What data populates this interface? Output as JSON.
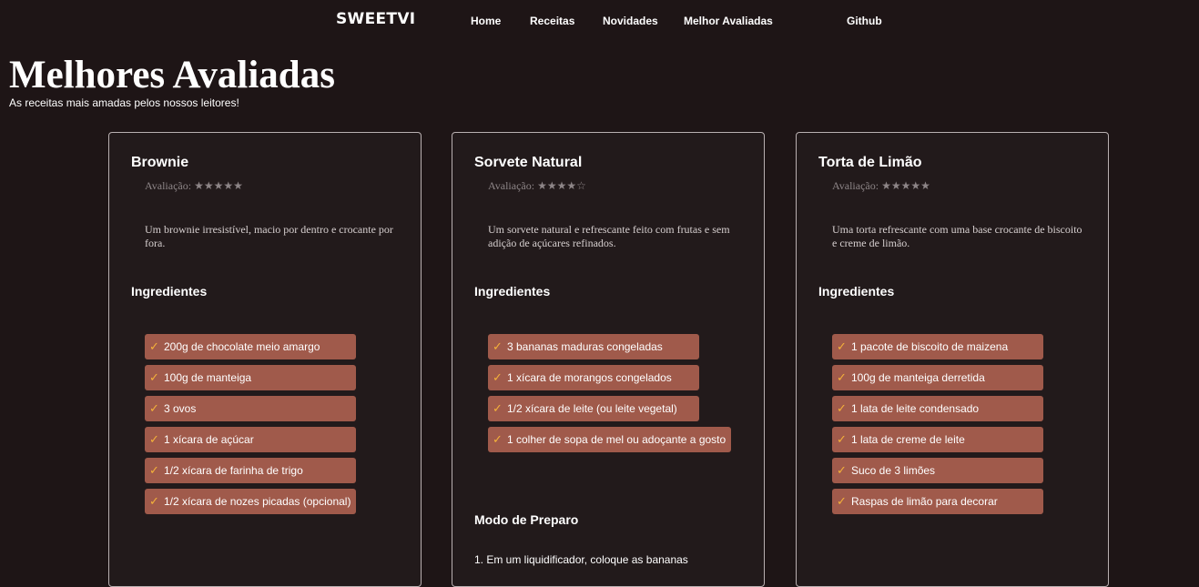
{
  "nav": {
    "brand": "SWEETVI",
    "links": [
      "Home",
      "Receitas",
      "Novidades",
      "Melhor Avaliadas",
      "Github"
    ]
  },
  "header": {
    "title": "Melhores Avaliadas",
    "subtitle": "As receitas mais amadas pelos nossos leitores!"
  },
  "colors": {
    "background": "#1e1516",
    "card_border": "#b9b0b1",
    "ingredient_bg": "#a05a4b",
    "check": "#f4b13a"
  },
  "cards": [
    {
      "title": "Brownie",
      "rating_label": "Avaliação:",
      "rating_stars": "★★★★★",
      "rating_value": 5,
      "description": "Um brownie irresistível, macio por dentro e crocante por fora.",
      "ingredients_heading": "Ingredientes",
      "check_icon": "✓",
      "ingredients": [
        "200g de chocolate meio amargo",
        "100g de manteiga",
        "3 ovos",
        "1 xícara de açúcar",
        "1/2 xícara de farinha de trigo",
        "1/2 xícara de nozes picadas (opcional)"
      ]
    },
    {
      "title": "Sorvete Natural",
      "rating_label": "Avaliação:",
      "rating_stars": "★★★★☆",
      "rating_value": 4,
      "description": "Um sorvete natural e refrescante feito com frutas e sem adição de açúcares refinados.",
      "ingredients_heading": "Ingredientes",
      "check_icon": "✓",
      "ingredients": [
        "3 bananas maduras congeladas",
        "1 xícara de morangos congelados",
        "1/2 xícara de leite (ou leite vegetal)",
        "1 colher de sopa de mel ou adoçante a gosto"
      ],
      "method_heading": "Modo de Preparo",
      "method_first_step": "1.   Em um liquidificador, coloque as bananas"
    },
    {
      "title": "Torta de Limão",
      "rating_label": "Avaliação:",
      "rating_stars": "★★★★★",
      "rating_value": 5,
      "description": "Uma torta refrescante com uma base crocante de biscoito e creme de limão.",
      "ingredients_heading": "Ingredientes",
      "check_icon": "✓",
      "ingredients": [
        "1 pacote de biscoito de maizena",
        "100g de manteiga derretida",
        "1 lata de leite condensado",
        "1 lata de creme de leite",
        "Suco de 3 limões",
        "Raspas de limão para decorar"
      ]
    }
  ]
}
